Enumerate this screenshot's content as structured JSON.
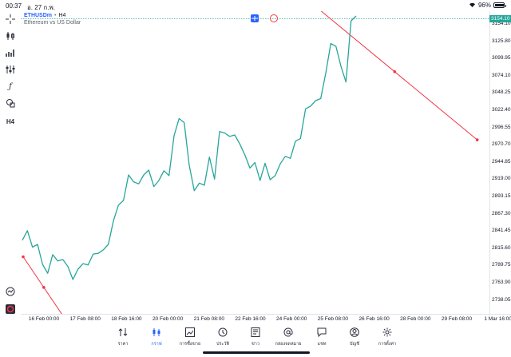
{
  "status": {
    "time": "00:37",
    "date": "อ. 27 ก.พ.",
    "battery": "96%",
    "battery_level": 0.96
  },
  "symbol": {
    "ticker": "ETHUSDm",
    "separator": "•",
    "timeframe": "H4",
    "description": "Ethereum vs US Dollar"
  },
  "price_axis": {
    "ticks": [
      "3154.10",
      "3125.80",
      "3099.95",
      "3074.10",
      "3048.25",
      "3022.40",
      "2996.55",
      "2970.70",
      "2944.85",
      "2919.00",
      "2893.15",
      "2867.30",
      "2841.45",
      "2815.60",
      "2789.75",
      "2763.90",
      "2738.05"
    ],
    "last_price": "3154.10"
  },
  "time_axis": {
    "ticks": [
      "16 Feb 00:00",
      "17 Feb 08:00",
      "18 Feb 16:00",
      "20 Feb 00:00",
      "21 Feb 08:00",
      "22 Feb 16:00",
      "24 Feb 00:00",
      "25 Feb 08:00",
      "26 Feb 16:00",
      "28 Feb 00:00",
      "29 Feb 08:00",
      "1 Mar 16:00"
    ]
  },
  "sidebar": {
    "tools": [
      "crosshair-icon",
      "candles-icon",
      "indicators-icon",
      "settings-sliders-icon",
      "function-icon",
      "drawing-shapes-icon"
    ],
    "timeframe_label": "H4"
  },
  "nav": {
    "items": [
      {
        "label": "ราคา",
        "icon": "sort-arrows-icon"
      },
      {
        "label": "กราฟ",
        "icon": "candles-icon"
      },
      {
        "label": "การซื้อขาย",
        "icon": "trade-chart-icon"
      },
      {
        "label": "ประวัติ",
        "icon": "history-icon"
      },
      {
        "label": "ข่าว",
        "icon": "news-icon"
      },
      {
        "label": "กล่องจดหมาย",
        "icon": "mail-at-icon"
      },
      {
        "label": "แชท",
        "icon": "chat-icon"
      },
      {
        "label": "บัญชี",
        "icon": "account-icon"
      },
      {
        "label": "การตั้งค่า",
        "icon": "settings-gear-icon"
      }
    ],
    "active_index": 1
  },
  "colors": {
    "line": "#26a69a",
    "trendline": "#f23645",
    "accent": "#2962ff"
  },
  "chart_data": {
    "type": "line",
    "title": "ETHUSDm • H4",
    "series": [
      {
        "name": "ETHUSDm",
        "values": [
          2832,
          2846,
          2822,
          2826,
          2797,
          2784,
          2811,
          2802,
          2804,
          2794,
          2775,
          2790,
          2798,
          2796,
          2812,
          2813,
          2818,
          2826,
          2860,
          2883,
          2890,
          2927,
          2917,
          2914,
          2927,
          2934,
          2910,
          2919,
          2933,
          2926,
          2984,
          3009,
          3003,
          2941,
          2904,
          2915,
          2912,
          2953,
          2921,
          2990,
          2988,
          2983,
          2985,
          2972,
          2956,
          2937,
          2945,
          2919,
          2944,
          2920,
          2926,
          2943,
          2954,
          2951,
          2976,
          2980,
          3023,
          3027,
          3035,
          3038,
          3075,
          3118,
          3114,
          3085,
          3062,
          3151,
          3158
        ]
      }
    ],
    "ylim": [
      2725,
      3165
    ],
    "trendlines": [
      {
        "from": [
          "16 Feb 00:00",
          2808
        ],
        "to": [
          "17 Feb 08:00",
          2719
        ]
      },
      {
        "from": [
          "25 Feb 08:00",
          3176
        ],
        "to": [
          "1 Mar 16:00",
          2978
        ]
      }
    ],
    "grid": false,
    "legend": "none"
  }
}
